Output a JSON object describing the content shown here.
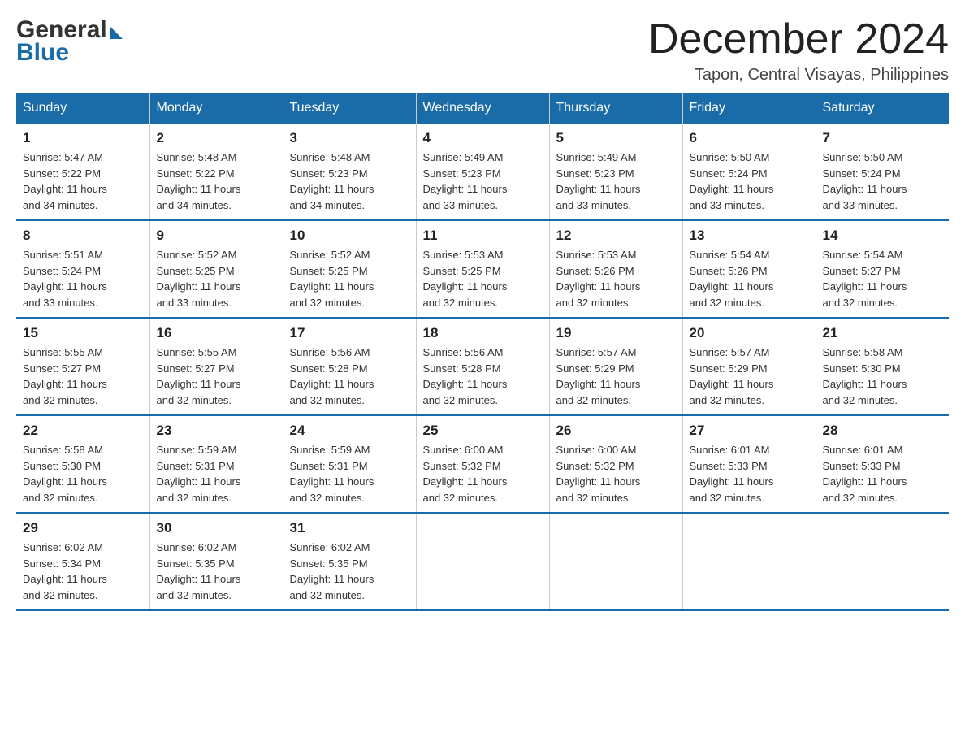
{
  "header": {
    "title": "December 2024",
    "subtitle": "Tapon, Central Visayas, Philippines",
    "logo_general": "General",
    "logo_blue": "Blue"
  },
  "days_of_week": [
    "Sunday",
    "Monday",
    "Tuesday",
    "Wednesday",
    "Thursday",
    "Friday",
    "Saturday"
  ],
  "weeks": [
    [
      {
        "day": "1",
        "sunrise": "5:47 AM",
        "sunset": "5:22 PM",
        "daylight": "11 hours and 34 minutes."
      },
      {
        "day": "2",
        "sunrise": "5:48 AM",
        "sunset": "5:22 PM",
        "daylight": "11 hours and 34 minutes."
      },
      {
        "day": "3",
        "sunrise": "5:48 AM",
        "sunset": "5:23 PM",
        "daylight": "11 hours and 34 minutes."
      },
      {
        "day": "4",
        "sunrise": "5:49 AM",
        "sunset": "5:23 PM",
        "daylight": "11 hours and 33 minutes."
      },
      {
        "day": "5",
        "sunrise": "5:49 AM",
        "sunset": "5:23 PM",
        "daylight": "11 hours and 33 minutes."
      },
      {
        "day": "6",
        "sunrise": "5:50 AM",
        "sunset": "5:24 PM",
        "daylight": "11 hours and 33 minutes."
      },
      {
        "day": "7",
        "sunrise": "5:50 AM",
        "sunset": "5:24 PM",
        "daylight": "11 hours and 33 minutes."
      }
    ],
    [
      {
        "day": "8",
        "sunrise": "5:51 AM",
        "sunset": "5:24 PM",
        "daylight": "11 hours and 33 minutes."
      },
      {
        "day": "9",
        "sunrise": "5:52 AM",
        "sunset": "5:25 PM",
        "daylight": "11 hours and 33 minutes."
      },
      {
        "day": "10",
        "sunrise": "5:52 AM",
        "sunset": "5:25 PM",
        "daylight": "11 hours and 32 minutes."
      },
      {
        "day": "11",
        "sunrise": "5:53 AM",
        "sunset": "5:25 PM",
        "daylight": "11 hours and 32 minutes."
      },
      {
        "day": "12",
        "sunrise": "5:53 AM",
        "sunset": "5:26 PM",
        "daylight": "11 hours and 32 minutes."
      },
      {
        "day": "13",
        "sunrise": "5:54 AM",
        "sunset": "5:26 PM",
        "daylight": "11 hours and 32 minutes."
      },
      {
        "day": "14",
        "sunrise": "5:54 AM",
        "sunset": "5:27 PM",
        "daylight": "11 hours and 32 minutes."
      }
    ],
    [
      {
        "day": "15",
        "sunrise": "5:55 AM",
        "sunset": "5:27 PM",
        "daylight": "11 hours and 32 minutes."
      },
      {
        "day": "16",
        "sunrise": "5:55 AM",
        "sunset": "5:27 PM",
        "daylight": "11 hours and 32 minutes."
      },
      {
        "day": "17",
        "sunrise": "5:56 AM",
        "sunset": "5:28 PM",
        "daylight": "11 hours and 32 minutes."
      },
      {
        "day": "18",
        "sunrise": "5:56 AM",
        "sunset": "5:28 PM",
        "daylight": "11 hours and 32 minutes."
      },
      {
        "day": "19",
        "sunrise": "5:57 AM",
        "sunset": "5:29 PM",
        "daylight": "11 hours and 32 minutes."
      },
      {
        "day": "20",
        "sunrise": "5:57 AM",
        "sunset": "5:29 PM",
        "daylight": "11 hours and 32 minutes."
      },
      {
        "day": "21",
        "sunrise": "5:58 AM",
        "sunset": "5:30 PM",
        "daylight": "11 hours and 32 minutes."
      }
    ],
    [
      {
        "day": "22",
        "sunrise": "5:58 AM",
        "sunset": "5:30 PM",
        "daylight": "11 hours and 32 minutes."
      },
      {
        "day": "23",
        "sunrise": "5:59 AM",
        "sunset": "5:31 PM",
        "daylight": "11 hours and 32 minutes."
      },
      {
        "day": "24",
        "sunrise": "5:59 AM",
        "sunset": "5:31 PM",
        "daylight": "11 hours and 32 minutes."
      },
      {
        "day": "25",
        "sunrise": "6:00 AM",
        "sunset": "5:32 PM",
        "daylight": "11 hours and 32 minutes."
      },
      {
        "day": "26",
        "sunrise": "6:00 AM",
        "sunset": "5:32 PM",
        "daylight": "11 hours and 32 minutes."
      },
      {
        "day": "27",
        "sunrise": "6:01 AM",
        "sunset": "5:33 PM",
        "daylight": "11 hours and 32 minutes."
      },
      {
        "day": "28",
        "sunrise": "6:01 AM",
        "sunset": "5:33 PM",
        "daylight": "11 hours and 32 minutes."
      }
    ],
    [
      {
        "day": "29",
        "sunrise": "6:02 AM",
        "sunset": "5:34 PM",
        "daylight": "11 hours and 32 minutes."
      },
      {
        "day": "30",
        "sunrise": "6:02 AM",
        "sunset": "5:35 PM",
        "daylight": "11 hours and 32 minutes."
      },
      {
        "day": "31",
        "sunrise": "6:02 AM",
        "sunset": "5:35 PM",
        "daylight": "11 hours and 32 minutes."
      },
      null,
      null,
      null,
      null
    ]
  ],
  "labels": {
    "sunrise": "Sunrise:",
    "sunset": "Sunset:",
    "daylight": "Daylight:"
  }
}
